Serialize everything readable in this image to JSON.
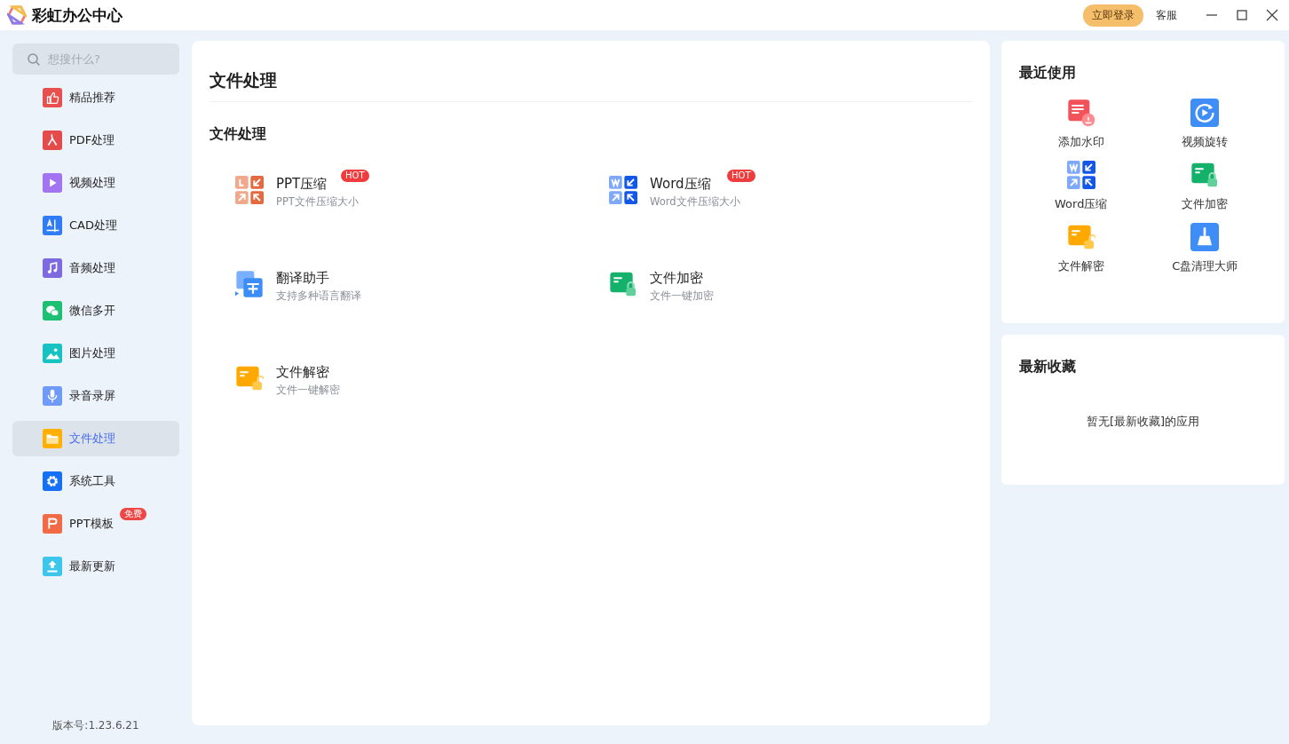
{
  "app": {
    "title": "彩虹办公中心",
    "login_button": "立即登录",
    "service_link": "客服"
  },
  "sidebar": {
    "search": {
      "placeholder": "想搜什么?"
    },
    "items": [
      {
        "label": "精品推荐",
        "kind": "thumb",
        "selected": false
      },
      {
        "label": "PDF处理",
        "kind": "pdf",
        "selected": false
      },
      {
        "label": "视频处理",
        "kind": "video",
        "selected": false
      },
      {
        "label": "CAD处理",
        "kind": "cad",
        "selected": false
      },
      {
        "label": "音频处理",
        "kind": "music",
        "selected": false
      },
      {
        "label": "微信多开",
        "kind": "chat",
        "selected": false
      },
      {
        "label": "图片处理",
        "kind": "image",
        "selected": false
      },
      {
        "label": "录音录屏",
        "kind": "mic",
        "selected": false
      },
      {
        "label": "文件处理",
        "kind": "folder",
        "selected": true
      },
      {
        "label": "系统工具",
        "kind": "gear",
        "selected": false
      },
      {
        "label": "PPT模板",
        "kind": "ppt",
        "selected": false,
        "badge": "免费"
      },
      {
        "label": "最新更新",
        "kind": "upload",
        "selected": false
      }
    ],
    "version": "版本号:1.23.6.21"
  },
  "main": {
    "title": "文件处理",
    "section": "文件处理",
    "tools": [
      {
        "title": "PPT压缩",
        "desc": "PPT文件压缩大小",
        "kind": "ppt-compress",
        "badge": "HOT"
      },
      {
        "title": "Word压缩",
        "desc": "Word文件压缩大小",
        "kind": "word-compress",
        "badge": "HOT"
      },
      {
        "title": "翻译助手",
        "desc": "支持多种语言翻译",
        "kind": "translate"
      },
      {
        "title": "文件加密",
        "desc": "文件一键加密",
        "kind": "lock"
      },
      {
        "title": "文件解密",
        "desc": "文件一键解密",
        "kind": "unlock"
      }
    ]
  },
  "recent": {
    "title": "最近使用",
    "items": [
      {
        "label": "添加水印",
        "kind": "watermark"
      },
      {
        "label": "视频旋转",
        "kind": "rotate"
      },
      {
        "label": "Word压缩",
        "kind": "word-compress"
      },
      {
        "label": "文件加密",
        "kind": "lock"
      },
      {
        "label": "文件解密",
        "kind": "unlock"
      },
      {
        "label": "C盘清理大师",
        "kind": "broom"
      }
    ]
  },
  "favorites": {
    "title": "最新收藏",
    "empty_text": "暂无[最新收藏]的应用"
  }
}
